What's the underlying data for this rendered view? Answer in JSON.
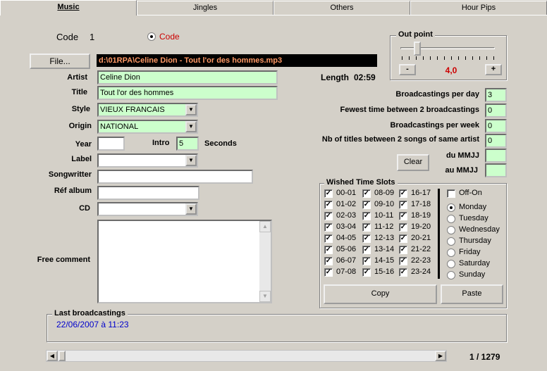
{
  "tabs": [
    "Music",
    "Jingles",
    "Others",
    "Hour Pips"
  ],
  "code": {
    "label": "Code",
    "value": "1",
    "radio_label": "Code"
  },
  "file": {
    "button": "File...",
    "path": "d:\\01RPA\\Celine Dion - Tout l'or des hommes.mp3"
  },
  "outpoint": {
    "title": "Out point",
    "minus": "-",
    "plus": "+",
    "value": "4,0"
  },
  "artist": {
    "label": "Artist",
    "value": "Celine Dion"
  },
  "title": {
    "label": "Title",
    "value": "Tout l'or des hommes"
  },
  "length": {
    "label": "Length",
    "value": "02:59"
  },
  "style": {
    "label": "Style",
    "value": "VIEUX FRANCAIS"
  },
  "origin": {
    "label": "Origin",
    "value": "NATIONAL"
  },
  "year": {
    "label": "Year",
    "value": ""
  },
  "intro": {
    "label": "Intro",
    "value": "5",
    "unit": "Seconds"
  },
  "label_field": {
    "label": "Label",
    "value": ""
  },
  "songwriter": {
    "label": "Songwritter",
    "value": ""
  },
  "ref_album": {
    "label": "Réf album",
    "value": ""
  },
  "cd": {
    "label": "CD",
    "value": ""
  },
  "free_comment": {
    "label": "Free comment",
    "value": ""
  },
  "stats": {
    "per_day": {
      "label": "Broadcastings per day",
      "value": "3"
    },
    "fewest": {
      "label": "Fewest time between 2 broadcastings",
      "value": "0"
    },
    "per_week": {
      "label": "Broadcastings per week",
      "value": "0"
    },
    "titles_between": {
      "label": "Nb of titles between 2 songs of same artist",
      "value": "0"
    },
    "du": {
      "label": "du MMJJ",
      "value": ""
    },
    "au": {
      "label": "au MMJJ",
      "value": ""
    },
    "clear": "Clear"
  },
  "slots": {
    "title": "Wished Time Slots",
    "col1": [
      "00-01",
      "01-02",
      "02-03",
      "03-04",
      "04-05",
      "05-06",
      "06-07",
      "07-08"
    ],
    "col2": [
      "08-09",
      "09-10",
      "10-11",
      "11-12",
      "12-13",
      "13-14",
      "14-15",
      "15-16"
    ],
    "col3": [
      "16-17",
      "17-18",
      "18-19",
      "19-20",
      "20-21",
      "21-22",
      "22-23",
      "23-24"
    ],
    "offon": "Off-On",
    "days": [
      "Monday",
      "Tuesday",
      "Wednesday",
      "Thursday",
      "Friday",
      "Saturday",
      "Sunday"
    ],
    "selected_day": "Monday",
    "copy": "Copy",
    "paste": "Paste"
  },
  "last": {
    "title": "Last broadcastings",
    "value": "22/06/2007 à 11:23"
  },
  "pager": {
    "value": "1 / 1279"
  },
  "colors": {
    "green_field": "#ccffcc",
    "path_bg": "#000000",
    "path_fg": "#ff9966",
    "red": "#cc0000",
    "blue": "#0000cc"
  }
}
